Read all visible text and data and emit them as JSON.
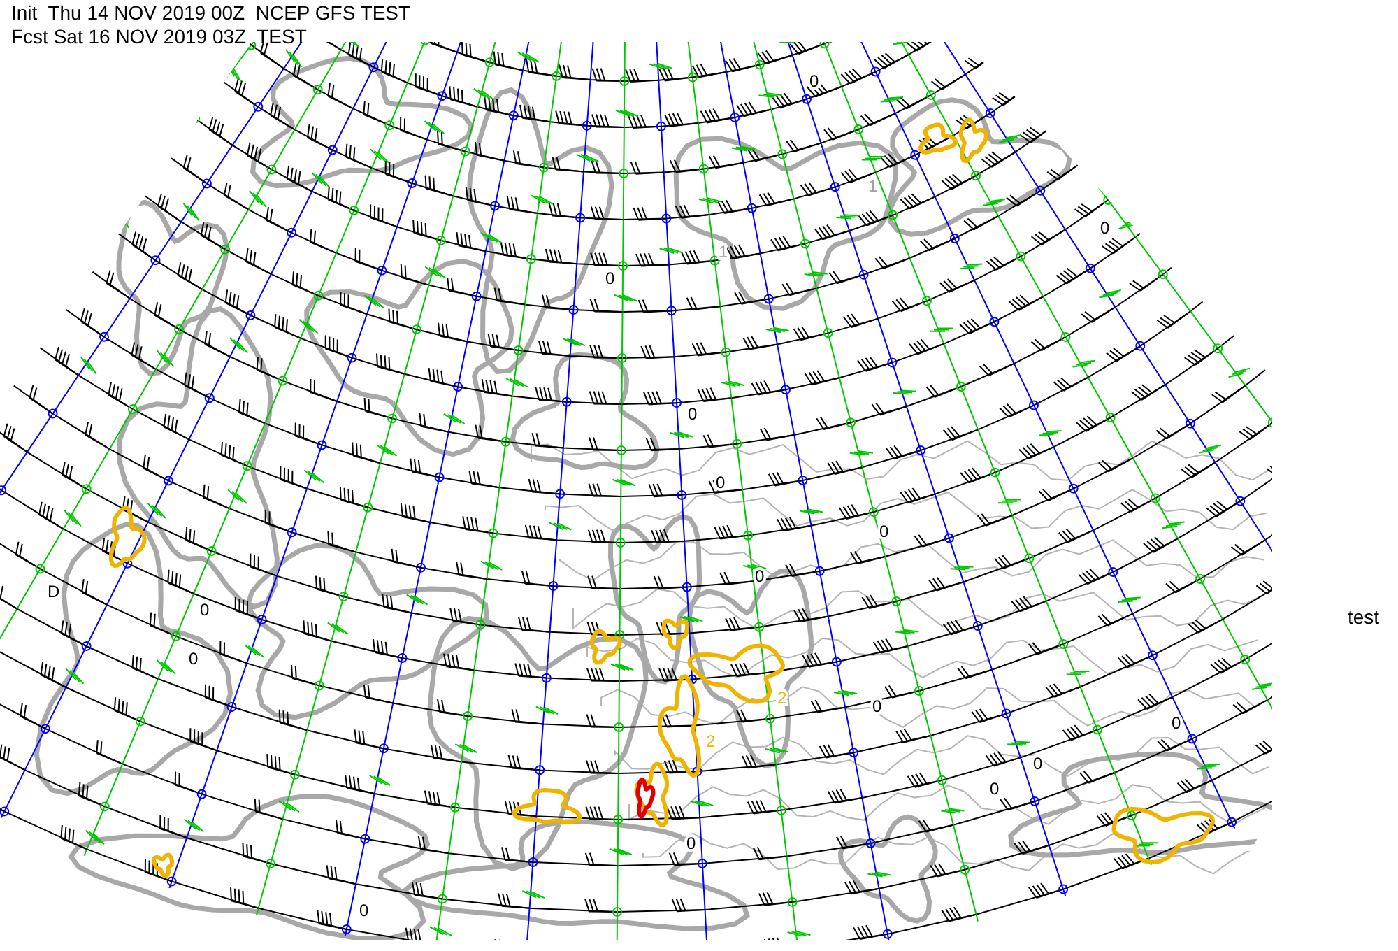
{
  "header": {
    "init_line": "Init  Thu 14 NOV 2019 00Z  NCEP GFS TEST",
    "forecast_line": "Fcst Sat 16 NOV 2019 03Z  TEST"
  },
  "side_label": "test",
  "contour_labels": [
    {
      "text": "0",
      "kind": "zero"
    },
    {
      "text": "0",
      "kind": "zero"
    },
    {
      "text": "0",
      "kind": "zero"
    },
    {
      "text": "0",
      "kind": "zero"
    },
    {
      "text": "0",
      "kind": "zero"
    },
    {
      "text": "0",
      "kind": "zero"
    },
    {
      "text": "D",
      "kind": "zero"
    },
    {
      "text": "0",
      "kind": "zero"
    },
    {
      "text": "0",
      "kind": "zero"
    },
    {
      "text": "0",
      "kind": "zero"
    },
    {
      "text": "0",
      "kind": "zero"
    },
    {
      "text": "0",
      "kind": "zero"
    },
    {
      "text": "0",
      "kind": "zero"
    },
    {
      "text": "0",
      "kind": "zero"
    },
    {
      "text": "0",
      "kind": "zero"
    },
    {
      "text": "0",
      "kind": "zero"
    },
    {
      "text": "1",
      "kind": "one"
    },
    {
      "text": "1",
      "kind": "one"
    },
    {
      "text": "2",
      "kind": "two"
    },
    {
      "text": "2",
      "kind": "two"
    }
  ]
}
